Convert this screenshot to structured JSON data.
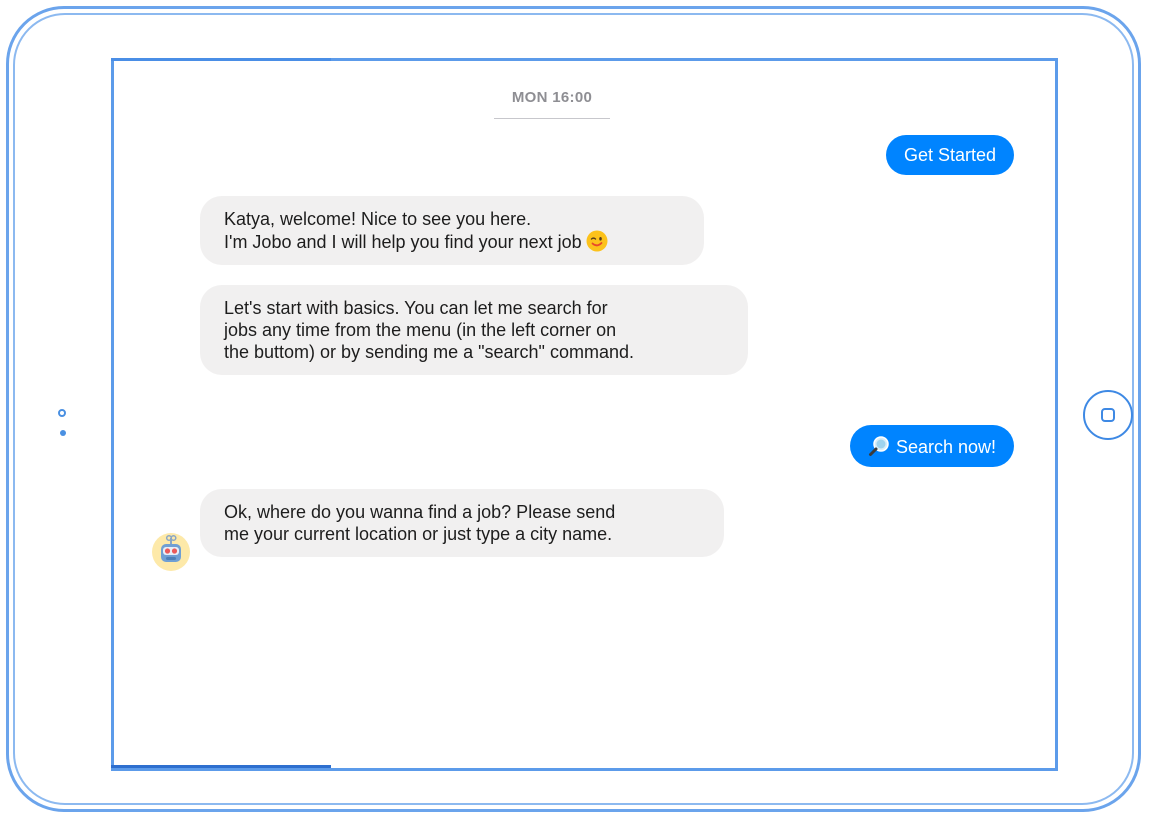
{
  "chat": {
    "timestamp": "MON 16:00",
    "get_started_label": "Get Started",
    "welcome": {
      "line1": "Katya, welcome! Nice to see you here.",
      "line2": "I'm Jobo and I will help you find your next job"
    },
    "basics": {
      "line1": "Let's start with basics. You can let me search for",
      "line2": "jobs any time from the menu (in the left corner on",
      "line3": "the buttom) or by sending me a \"search\" command."
    },
    "search_now_label": "Search now!",
    "location": {
      "line1": "Ok, where do you wanna find a job? Please send",
      "line2": "me your current location or just type a city name."
    }
  },
  "colors": {
    "user_bubble": "#0084ff",
    "bot_bubble": "#f1f0f0",
    "device_outline": "#5c9bea"
  },
  "icons": {
    "wink": "winking-face-emoji-icon",
    "search": "magnifying-glass-icon",
    "avatar": "robot-avatar-icon",
    "home": "home-button-icon"
  }
}
